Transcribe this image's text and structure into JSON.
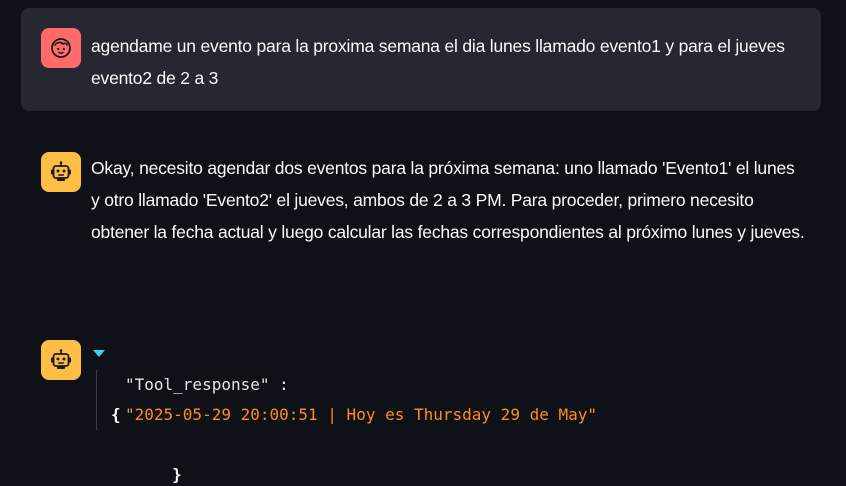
{
  "messages": [
    {
      "role": "user",
      "avatar_icon": "user-face-icon",
      "text": "agendame un evento para la proxima semana el dia lunes llamado evento1 y para el jueves evento2 de 2 a 3"
    },
    {
      "role": "assistant",
      "avatar_icon": "robot-icon",
      "text": "Okay, necesito agendar dos eventos para la próxima semana: uno llamado 'Evento1' el lunes y otro llamado 'Evento2' el jueves, ambos de 2 a 3 PM. Para proceder, primero necesito obtener la fecha actual y luego calcular las fechas correspondientes al próximo lunes y jueves."
    },
    {
      "role": "assistant",
      "avatar_icon": "robot-icon",
      "json": {
        "open_brace": "{",
        "key": "\"Tool_response\"",
        "colon": " :",
        "value": "\"2025-05-29 20:00:51 | Hoy es Thursday 29 de May\"",
        "close_brace": "}"
      }
    }
  ],
  "colors": {
    "background": "#0e1117",
    "user_bubble": "#262730",
    "user_avatar": "#ff6b6b",
    "bot_avatar": "#ffbd45",
    "json_string": "#ff8c1a",
    "json_toggle": "#3dd2f0"
  }
}
